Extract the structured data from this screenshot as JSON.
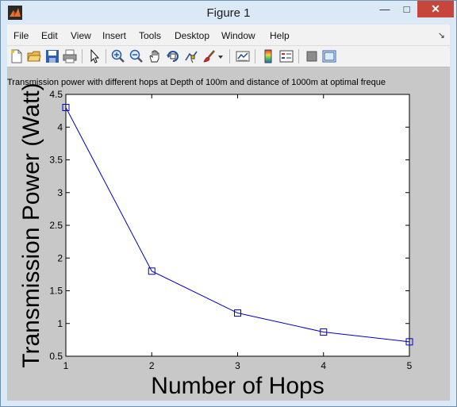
{
  "window": {
    "title": "Figure 1",
    "minimize_glyph": "—",
    "maximize_glyph": "□",
    "close_glyph": "✕"
  },
  "menu": {
    "items": [
      "File",
      "Edit",
      "View",
      "Insert",
      "Tools",
      "Desktop",
      "Window",
      "Help"
    ],
    "dock_glyph": "↘"
  },
  "toolbar": {
    "icons": [
      "new-figure-icon",
      "open-file-icon",
      "save-icon",
      "print-icon",
      "edit-plot-arrow-icon",
      "zoom-in-icon",
      "zoom-out-icon",
      "pan-hand-icon",
      "rotate-3d-icon",
      "data-cursor-icon",
      "brush-icon",
      "brush-dropdown-icon",
      "link-plot-icon",
      "colorbar-icon",
      "legend-icon",
      "hide-plot-tools-icon",
      "show-plot-tools-icon"
    ]
  },
  "colors": {
    "series": "#0000cc",
    "figure_bg": "#c8c8c8",
    "axes_bg": "#ffffff",
    "close_button": "#c7463c"
  },
  "chart_data": {
    "type": "line",
    "title": "Transmission power with different hops at Depth of 100m and distance of 1000m at optimal freque",
    "xlabel": "Number of Hops",
    "ylabel": "Transmission Power (Watt)",
    "x": [
      1,
      2,
      3,
      4,
      5
    ],
    "series": [
      {
        "values": [
          4.3,
          1.8,
          1.16,
          0.87,
          0.72
        ],
        "marker": "square",
        "color": "#0000cc"
      }
    ],
    "xlim": [
      1,
      5
    ],
    "ylim": [
      0.5,
      4.5
    ],
    "xticks": [
      "1",
      "2",
      "3",
      "4",
      "5"
    ],
    "yticks": [
      "0.5",
      "1",
      "1.5",
      "2",
      "2.5",
      "3",
      "3.5",
      "4",
      "4.5"
    ],
    "grid": false
  }
}
